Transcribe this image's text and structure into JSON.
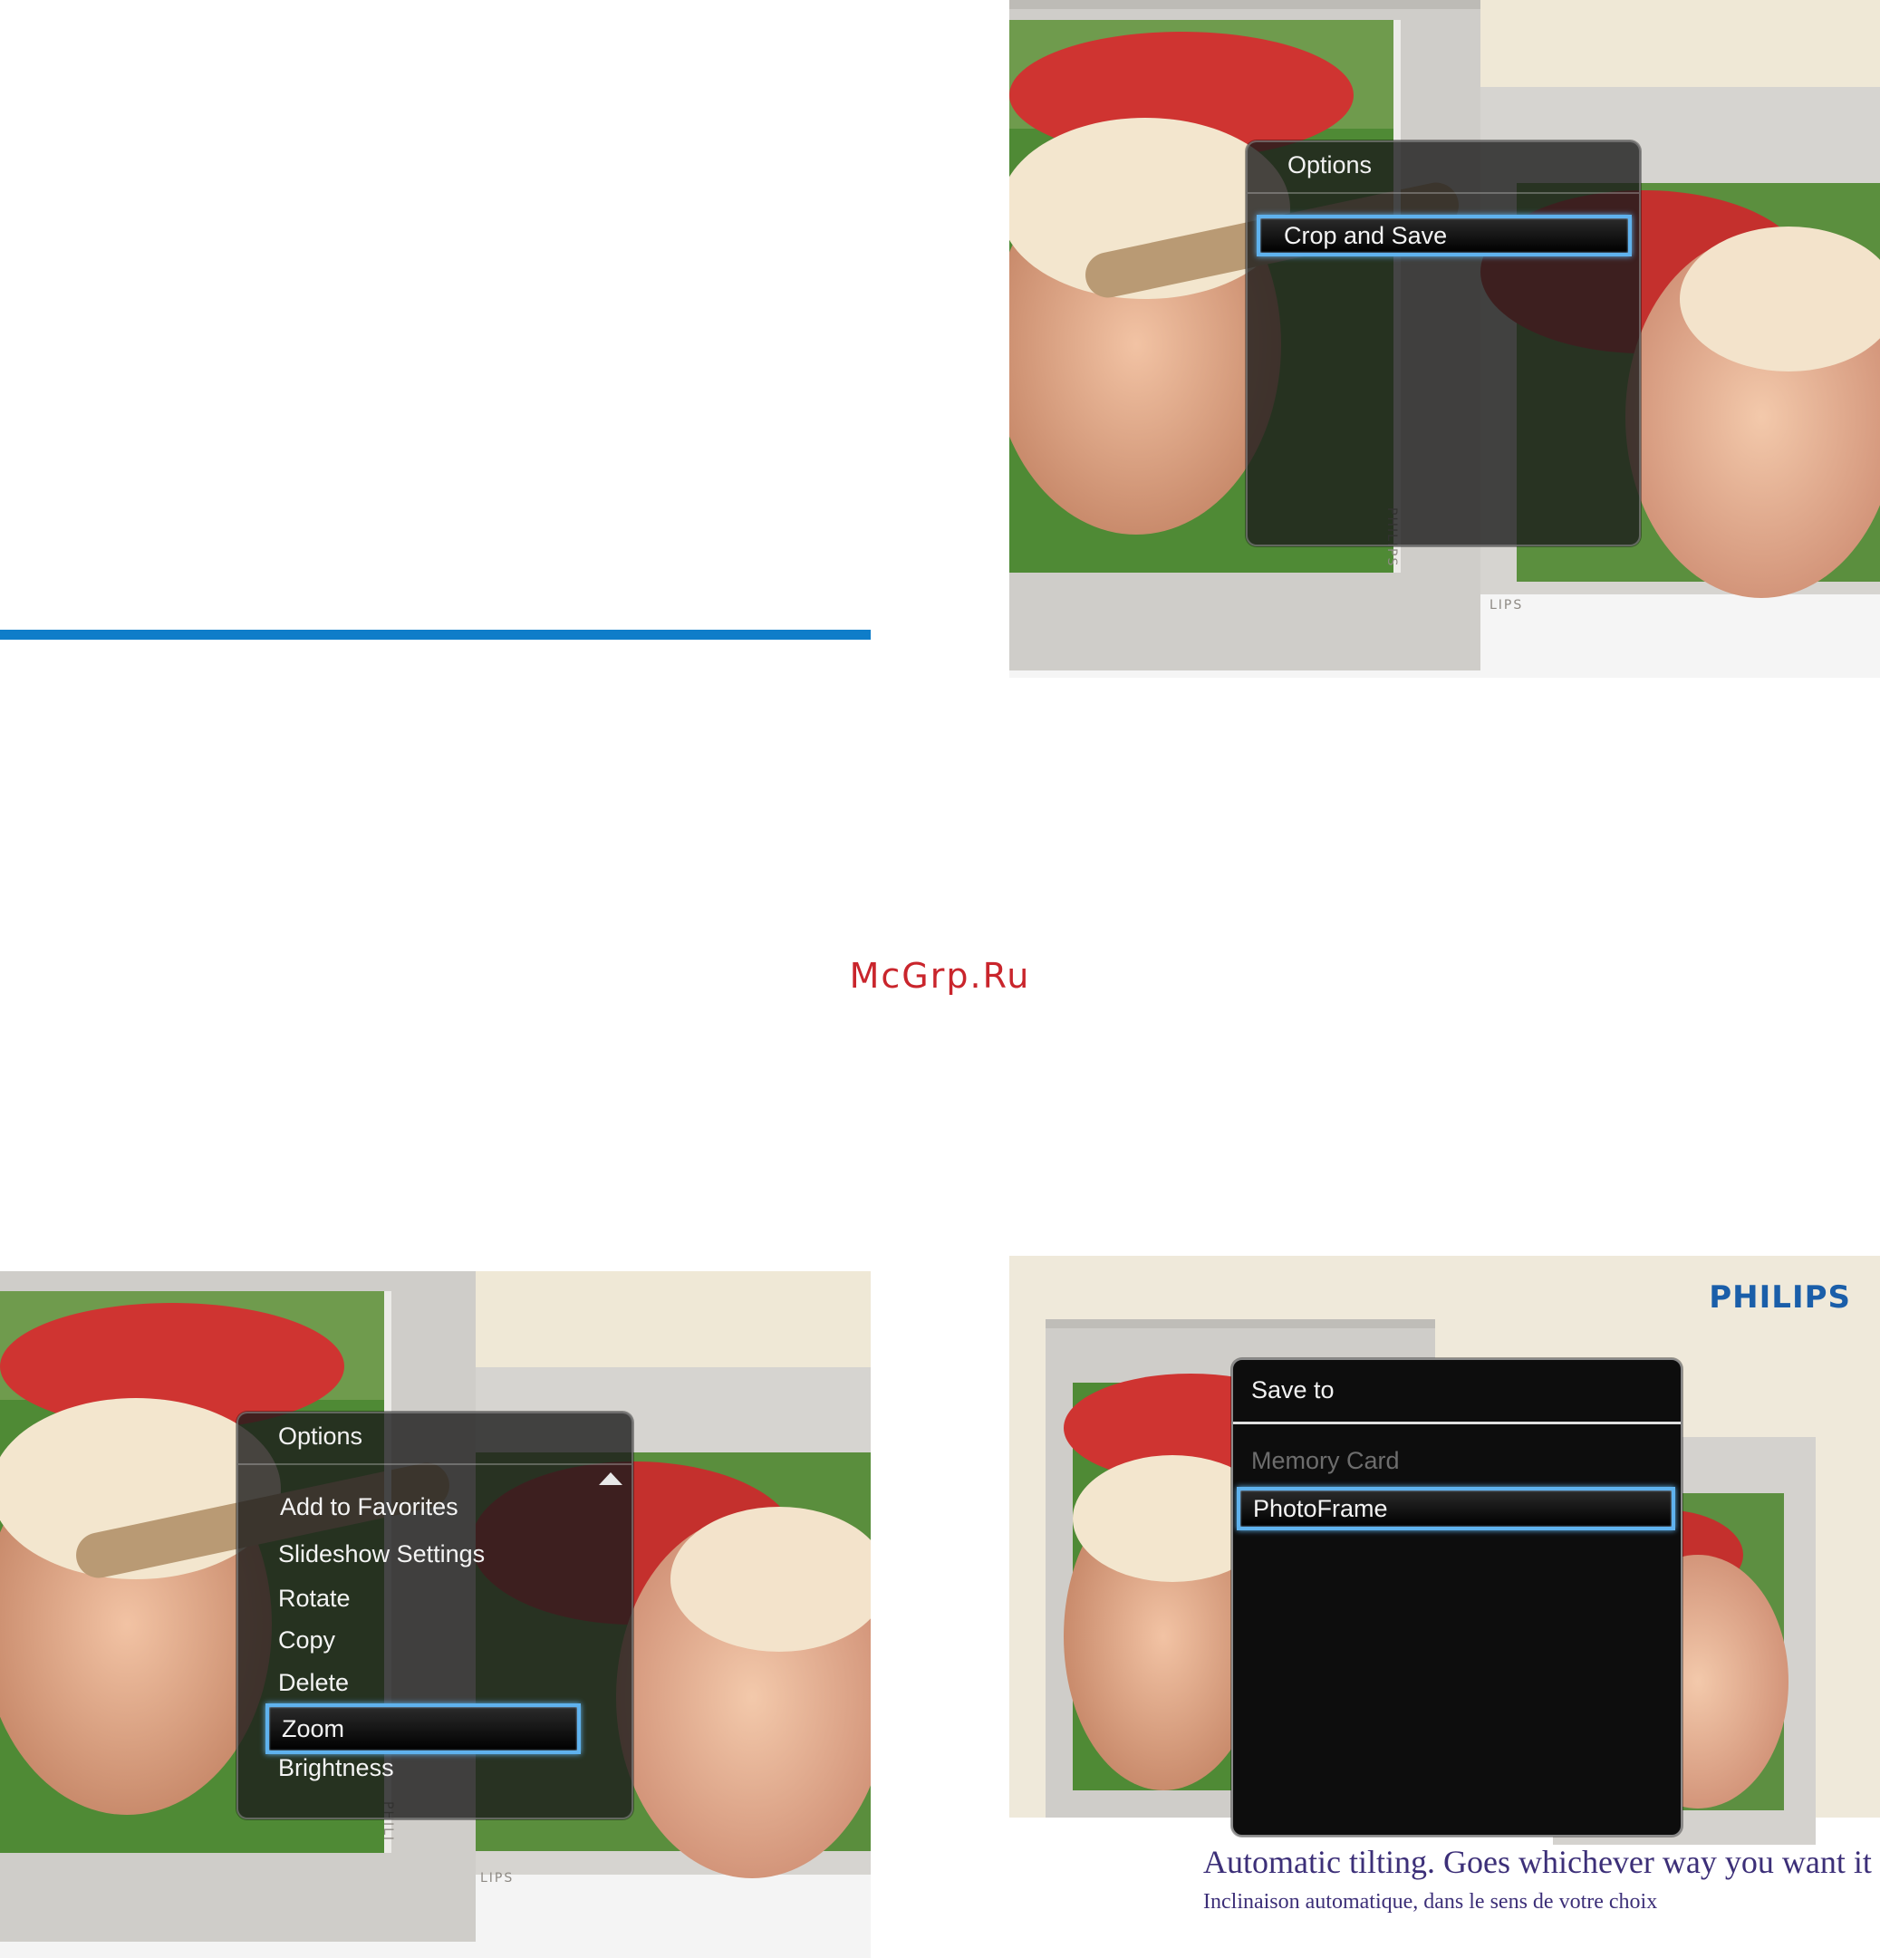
{
  "watermark": "McGrp.Ru",
  "panel_top_right": {
    "menu": {
      "title": "Options",
      "items": [
        {
          "label": "Crop and Save",
          "selected": true
        }
      ]
    },
    "frame_brand": "PHILIPS",
    "frame_brand_partial": "LIPS"
  },
  "panel_bottom_left": {
    "menu": {
      "title": "Options",
      "items": [
        {
          "label": "Add to Favorites",
          "selected": false
        },
        {
          "label": "Slideshow Settings",
          "selected": false
        },
        {
          "label": "Rotate",
          "selected": false
        },
        {
          "label": "Copy",
          "selected": false
        },
        {
          "label": "Delete",
          "selected": false
        },
        {
          "label": "Zoom",
          "selected": true
        },
        {
          "label": "Brightness",
          "selected": false
        }
      ]
    },
    "frame_brand": "PHILI",
    "frame_brand_partial": "LIPS"
  },
  "panel_bottom_right": {
    "logo": "PHILIPS",
    "menu": {
      "title": "Save to",
      "items": [
        {
          "label": "Memory Card",
          "selected": false,
          "disabled": true
        },
        {
          "label": "PhotoFrame",
          "selected": true
        }
      ]
    },
    "tagline_en": "Automatic tilting. Goes whichever way you want it",
    "tagline_fr": "Inclinaison automatique, dans le sens de votre choix"
  },
  "colors": {
    "rule_blue": "#0f7dc9",
    "watermark_red": "#c9252c",
    "selection_blue": "#5fb2ee",
    "logo_blue": "#1a5ea9",
    "tagline_purple": "#3c2f78"
  }
}
